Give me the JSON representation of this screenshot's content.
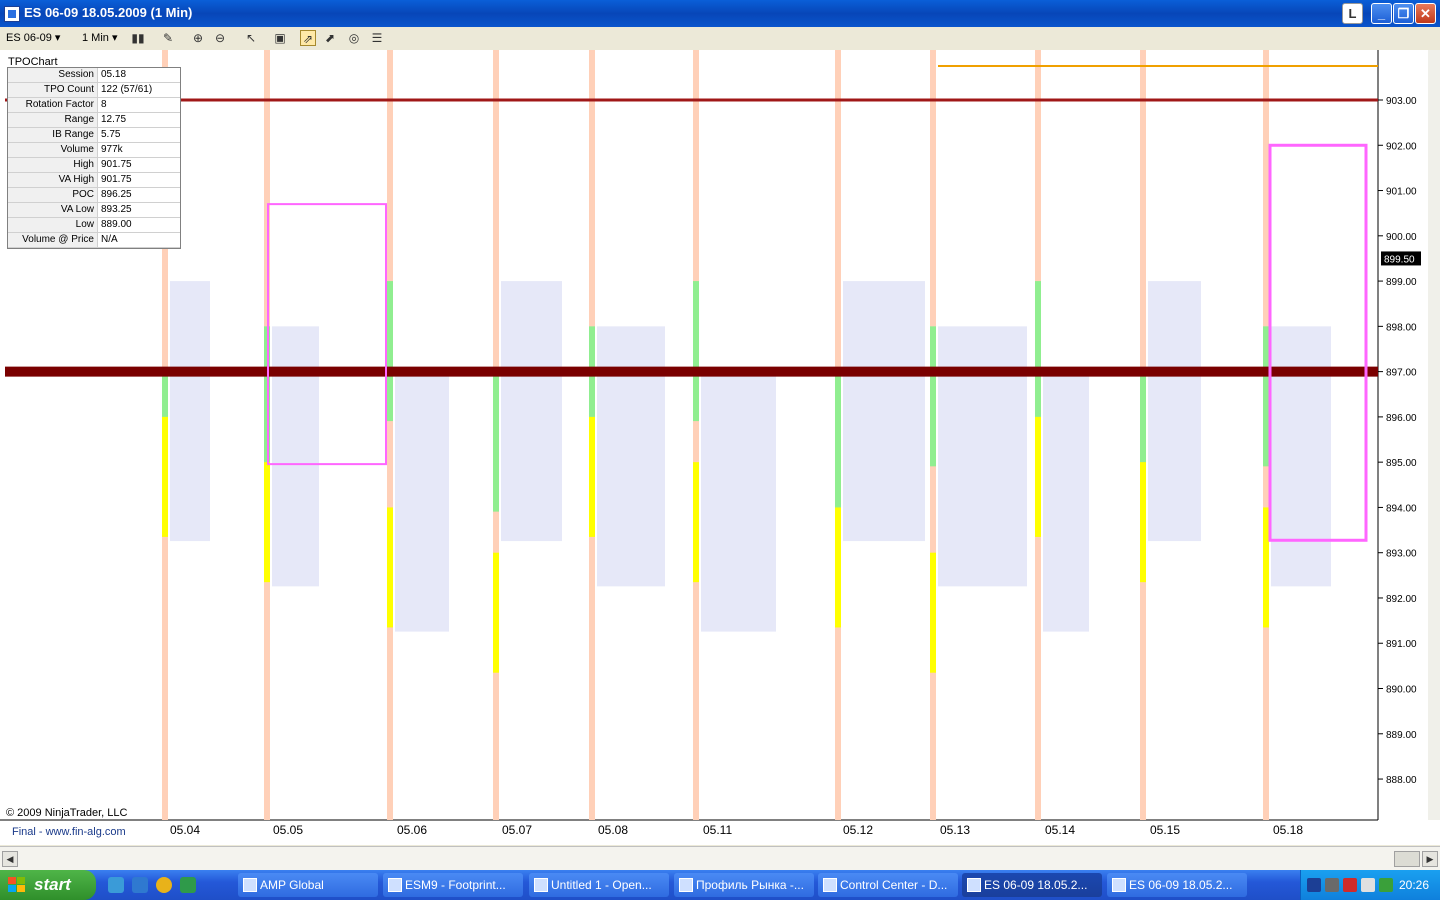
{
  "window": {
    "title": "ES 06-09  18.05.2009 (1 Min)",
    "btn_l": "L",
    "btn_min": "_",
    "btn_max": "❐",
    "btn_close": "✕"
  },
  "toolbar": {
    "instrument": "ES 06-09",
    "interval": "1 Min"
  },
  "stats": {
    "title": "TPOChart",
    "rows": [
      {
        "label": "Session",
        "value": "05.18"
      },
      {
        "label": "TPO Count",
        "value": "122 (57/61)"
      },
      {
        "label": "Rotation Factor",
        "value": "8"
      },
      {
        "label": "Range",
        "value": "12.75"
      },
      {
        "label": "IB Range",
        "value": "5.75"
      },
      {
        "label": "Volume",
        "value": "977k"
      },
      {
        "label": "High",
        "value": "901.75"
      },
      {
        "label": "VA High",
        "value": "901.75"
      },
      {
        "label": "POC",
        "value": "896.25"
      },
      {
        "label": "VA Low",
        "value": "893.25"
      },
      {
        "label": "Low",
        "value": "889.00"
      },
      {
        "label": "Volume @ Price",
        "value": "N/A"
      }
    ]
  },
  "chart": {
    "price_labels": [
      "903.00",
      "902.00",
      "901.00",
      "900.00",
      "899.00",
      "898.00",
      "897.00",
      "896.00",
      "895.00",
      "894.00",
      "893.00",
      "892.00",
      "891.00",
      "890.00",
      "889.00",
      "888.00"
    ],
    "current_price": "899.50",
    "date_labels": [
      "05.04",
      "05.05",
      "05.06",
      "05.07",
      "05.08",
      "05.11",
      "05.12",
      "05.13",
      "05.14",
      "05.15",
      "05.18"
    ],
    "copyright": "© 2009 NinjaTrader, LLC",
    "source": "Final - www.fin-alg.com",
    "colors": {
      "red_line": "#a01818",
      "dark_red_line": "#7a0000",
      "poc": "#f0a000",
      "value_area": "#ff66ff"
    }
  },
  "chart_data": {
    "type": "table",
    "y_axis": {
      "min": 887.5,
      "max": 903.5,
      "tick_step": 1
    },
    "horizontal_lines": [
      {
        "price": 903.0
      },
      {
        "price": 897.0
      }
    ],
    "sessions": [
      "05.04",
      "05.05",
      "05.06",
      "05.07",
      "05.08",
      "05.11",
      "05.12",
      "05.13",
      "05.14",
      "05.15",
      "05.18"
    ]
  },
  "taskbar": {
    "start": "start",
    "tasks": [
      "AMP Global",
      "ESM9 - Footprint...",
      "Untitled 1 - Open...",
      "Профиль Рынка -...",
      "Control Center - D...",
      "ES 06-09  18.05.2...",
      "ES 06-09  18.05.2..."
    ],
    "clock": "20:26"
  }
}
